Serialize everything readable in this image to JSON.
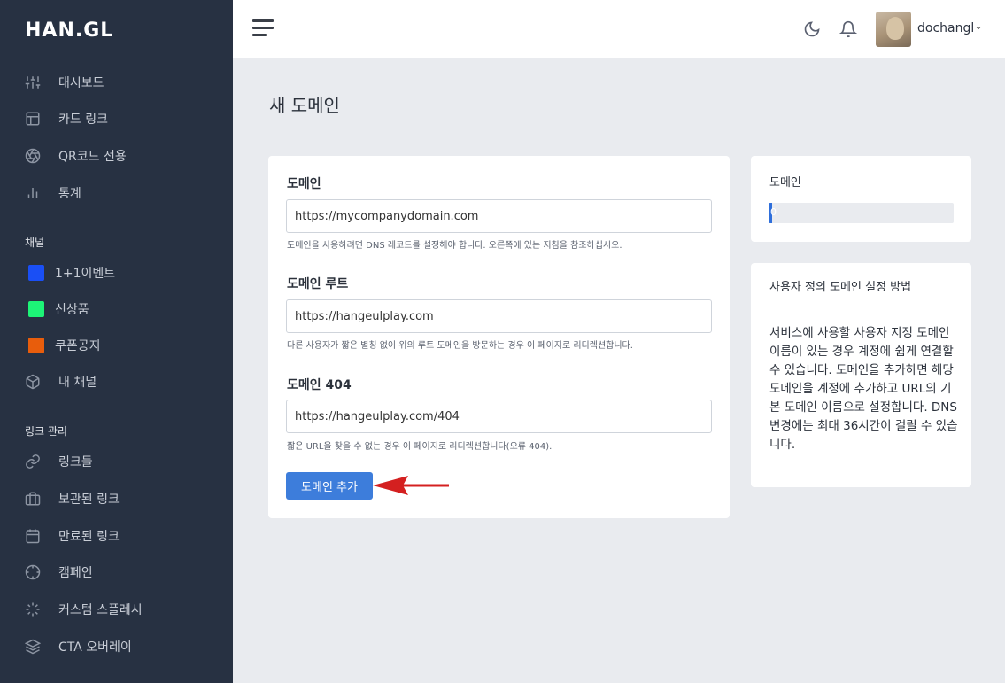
{
  "brand": {
    "logo": "HAN.GL"
  },
  "sidebar": {
    "items": [
      {
        "label": "대시보드",
        "icon": "sliders-icon"
      },
      {
        "label": "카드 링크",
        "icon": "layout-icon"
      },
      {
        "label": "QR코드 전용",
        "icon": "aperture-icon"
      },
      {
        "label": "통계",
        "icon": "bar-chart-icon"
      }
    ],
    "channels_label": "채널",
    "channels": [
      {
        "label": "1+1이벤트",
        "color": "#1a4ff5"
      },
      {
        "label": "신상품",
        "color": "#1df477"
      },
      {
        "label": "쿠폰공지",
        "color": "#e85d0c"
      },
      {
        "label": "내 채널",
        "icon": "box-icon"
      }
    ],
    "links_label": "링크 관리",
    "links": [
      {
        "label": "링크들",
        "icon": "link-icon"
      },
      {
        "label": "보관된 링크",
        "icon": "briefcase-icon"
      },
      {
        "label": "만료된 링크",
        "icon": "calendar-icon"
      },
      {
        "label": "캠페인",
        "icon": "crosshair-icon"
      },
      {
        "label": "커스텀 스플레시",
        "icon": "loader-icon"
      },
      {
        "label": "CTA 오버레이",
        "icon": "layers-icon"
      }
    ]
  },
  "header": {
    "user_name": "dochangl",
    "theme_icon": "moon-icon",
    "notify_icon": "bell-icon"
  },
  "page": {
    "title": "새 도메인"
  },
  "form": {
    "domain_label": "도메인",
    "domain_value": "https://mycompanydomain.com",
    "domain_help": "도메인을 사용하려면 DNS 레코드를 설정해야 합니다. 오른쪽에 있는 지침을 참조하십시오.",
    "root_label": "도메인 루트",
    "root_value": "https://hangeulplay.com",
    "root_help": "다른 사용자가 짧은 별칭 없이 위의 루트 도메인을 방문하는 경우 이 페이지로 리디렉션합니다.",
    "notfound_label": "도메인 404",
    "notfound_value": "https://hangeulplay.com/404",
    "notfound_help": "짧은 URL을 찾을 수 없는 경우 이 페이지로 리디렉션합니다(오류 404).",
    "submit_label": "도메인 추가"
  },
  "domain_card": {
    "title": "도메인",
    "progress_text": "0",
    "progress_fraction": 0.02,
    "progress_color": "#2f6fdb"
  },
  "help_card": {
    "title": "사용자 정의 도메인 설정 방법",
    "body": "서비스에 사용할 사용자 지정 도메인 이름이 있는 경우 계정에 쉽게 연결할 수 있습니다. 도메인을 추가하면 해당 도메인을 계정에 추가하고 URL의 기본 도메인 이름으로 설정합니다. DNS 변경에는 최대 36시간이 걸릴 수 있습니다."
  },
  "colors": {
    "accent": "#3d7ddb",
    "sidebar_bg": "#273142",
    "annotation_arrow": "#d42020"
  }
}
